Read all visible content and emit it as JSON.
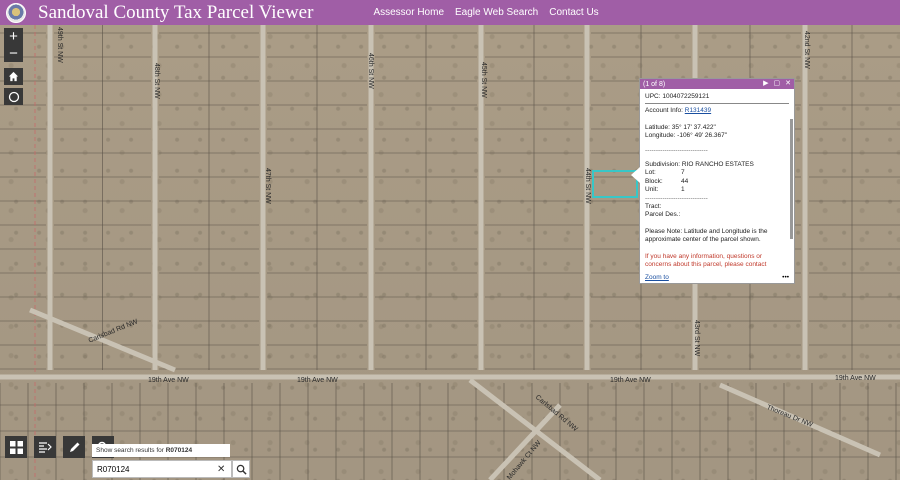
{
  "header": {
    "title": "Sandoval County Tax Parcel Viewer",
    "nav": [
      "Assessor Home",
      "Eagle Web Search",
      "Contact Us"
    ],
    "accent": "#a05ea6"
  },
  "map": {
    "vertical_roads": [
      "49th St NW",
      "48th St NW",
      "47th St NW",
      "46th St NW",
      "45th St NW",
      "44th St NW",
      "43rd St NW",
      "42nd St NW"
    ],
    "horizontal_roads": [
      "19th Ave NW",
      "19th Ave NW",
      "19th Ave NW",
      "19th Ave NW"
    ],
    "diagonal_roads": [
      "Carlsbad Rd NW",
      "Carlsbad Rd NW",
      "Thoreau Dr NW",
      "Mohawk Ct NW"
    ],
    "highlight_color": "#38c7c7"
  },
  "controls": {
    "zoom_in": "+",
    "zoom_out": "−",
    "home_icon": "home-icon",
    "locate_icon": "locate-icon"
  },
  "popup": {
    "counter": "(1 of 8)",
    "upc": "UPC: 1004072259121",
    "account_label": "Account Info: ",
    "account_link": "R131439",
    "latitude": "Latitude: 35° 17' 37.422\"",
    "longitude": "Longitude: -106° 49' 26.367\"",
    "subdivision": "Subdivision: RIO RANCHO ESTATES",
    "lot_label": "Lot:",
    "lot_value": "7",
    "block_label": "Block:",
    "block_value": "44",
    "unit_label": "Unit:",
    "unit_value": "1",
    "tract": "Tract:",
    "parcel_des": "Parcel Des.:",
    "note": "Please Note: Latitude and Longitude is the approximate center of the parcel shown.",
    "contact": "If you have any information, questions or concerns about this parcel, please contact",
    "zoom_to": "Zoom to",
    "more": "•••"
  },
  "search": {
    "hint_prefix": "Show search results for ",
    "hint_term": "R070124",
    "value": "R070124",
    "clear": "✕"
  }
}
